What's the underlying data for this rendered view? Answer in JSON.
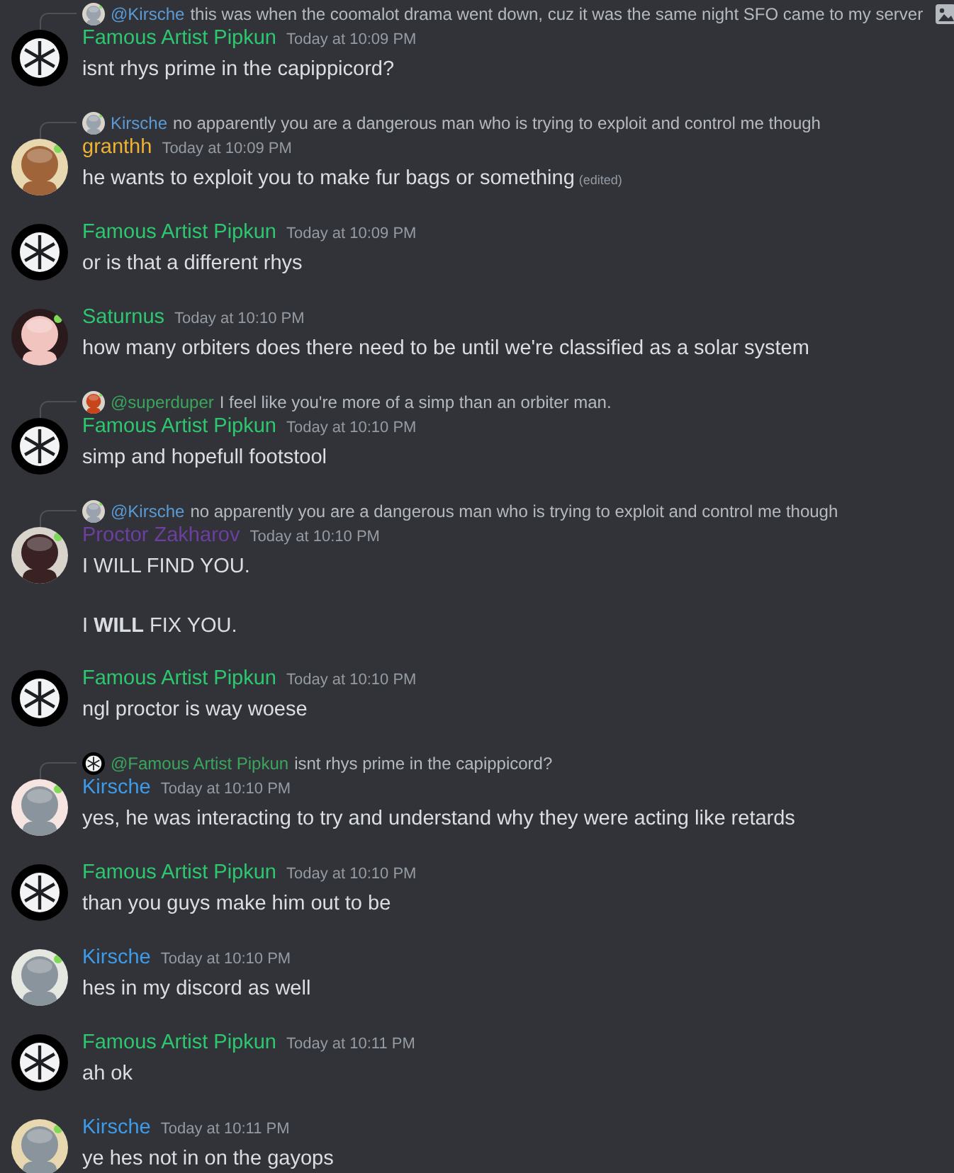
{
  "messages": [
    {
      "author": "Famous Artist Pipkun",
      "color": "#2dc770",
      "avatar": {
        "kind": "icon"
      },
      "time": "Today at 10:09 PM",
      "lines": [
        "isnt rhys prime in the capippicord?"
      ],
      "reply": {
        "avatar": {
          "kind": "picture",
          "color": "#9aa3ad"
        },
        "mention": "@Kirsche",
        "color": "#5b9bd5",
        "text": "this was when the coomalot drama went down, cuz it was the same night SFO came to my server",
        "attachment": true
      }
    },
    {
      "author": "granthh",
      "color": "#f0b232",
      "avatar": {
        "kind": "picture",
        "color": "#a0643a"
      },
      "time": "Today at 10:09 PM",
      "lines": [
        "he wants to exploit you to make fur bags or something"
      ],
      "edited": "(edited)",
      "reply": {
        "avatar": {
          "kind": "picture",
          "color": "#9aa3ad"
        },
        "mention": "Kirsche",
        "color": "#5b9bd5",
        "text": "no apparently you are a dangerous man who is trying to exploit and control me though",
        "attachment": false
      }
    },
    {
      "author": "Famous Artist Pipkun",
      "color": "#2dc770",
      "avatar": {
        "kind": "icon"
      },
      "time": "Today at 10:09 PM",
      "lines": [
        "or is that a different rhys"
      ]
    },
    {
      "author": "Saturnus",
      "color": "#2dc770",
      "avatar": {
        "kind": "picture",
        "color": "#f2c4c0"
      },
      "time": "Today at 10:10 PM",
      "lines": [
        "how many orbiters does there need to be until we're classified as a solar system"
      ]
    },
    {
      "author": "Famous Artist Pipkun",
      "color": "#2dc770",
      "avatar": {
        "kind": "icon"
      },
      "time": "Today at 10:10 PM",
      "lines": [
        "simp and hopefull footstool"
      ],
      "reply": {
        "avatar": {
          "kind": "picture",
          "color": "#c8451c"
        },
        "mention": "@superduper",
        "color": "#3ba55c",
        "text": "I feel like you're more of a simp than an orbiter man.",
        "attachment": false
      }
    },
    {
      "author": "Proctor Zakharov",
      "color": "#6c3fa0",
      "avatar": {
        "kind": "picture",
        "color": "#3a2224"
      },
      "time": "Today at 10:10 PM",
      "lines": [
        "I WILL FIND YOU.",
        "I **WILL** FIX YOU."
      ],
      "reply": {
        "avatar": {
          "kind": "picture",
          "color": "#9aa3ad"
        },
        "mention": "@Kirsche",
        "color": "#5b9bd5",
        "text": "no apparently you are a dangerous man who is trying to exploit and control me though",
        "attachment": false
      }
    },
    {
      "author": "Famous Artist Pipkun",
      "color": "#2dc770",
      "avatar": {
        "kind": "icon"
      },
      "time": "Today at 10:10 PM",
      "lines": [
        "ngl proctor is way woese"
      ]
    },
    {
      "author": "Kirsche",
      "color": "#3e9be9",
      "avatar": {
        "kind": "picture",
        "color": "#8a949c"
      },
      "time": "Today at 10:10 PM",
      "lines": [
        "yes, he was interacting to try and understand why they were acting like retards"
      ],
      "reply": {
        "avatar": {
          "kind": "icon"
        },
        "mention": "@Famous Artist Pipkun",
        "color": "#3ba55c",
        "text": "isnt rhys prime in the capippicord?",
        "attachment": false
      }
    },
    {
      "author": "Famous Artist Pipkun",
      "color": "#2dc770",
      "avatar": {
        "kind": "icon"
      },
      "time": "Today at 10:10 PM",
      "lines": [
        "than you guys make him out to be"
      ]
    },
    {
      "author": "Kirsche",
      "color": "#3e9be9",
      "avatar": {
        "kind": "picture",
        "color": "#8a949c"
      },
      "time": "Today at 10:10 PM",
      "lines": [
        "hes in my discord as well"
      ]
    },
    {
      "author": "Famous Artist Pipkun",
      "color": "#2dc770",
      "avatar": {
        "kind": "icon"
      },
      "time": "Today at 10:11 PM",
      "lines": [
        "ah ok"
      ]
    },
    {
      "author": "Kirsche",
      "color": "#3e9be9",
      "avatar": {
        "kind": "picture",
        "color": "#8a949c"
      },
      "time": "Today at 10:11 PM",
      "lines": [
        "ye hes not in on the gayops"
      ]
    }
  ]
}
